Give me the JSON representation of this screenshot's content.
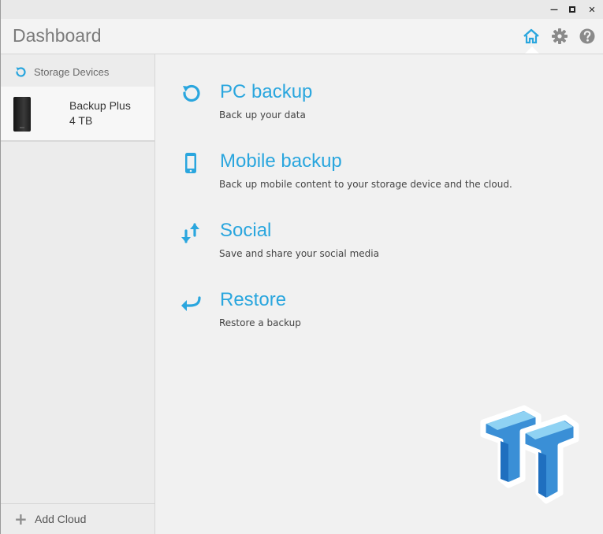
{
  "window": {
    "minimize_glyph": "—",
    "maximize_glyph": "▣",
    "close_glyph": "✕"
  },
  "header": {
    "title": "Dashboard",
    "icons": [
      "home-icon",
      "gear-icon",
      "help-icon"
    ]
  },
  "sidebar": {
    "section_title": "Storage Devices",
    "devices": [
      {
        "name": "Backup Plus",
        "capacity": "4 TB"
      }
    ],
    "add_cloud_label": "Add Cloud"
  },
  "actions": [
    {
      "title": "PC backup",
      "description": "Back up your data",
      "icon": "refresh-icon"
    },
    {
      "title": "Mobile backup",
      "description": "Back up mobile content to your storage device and the cloud.",
      "icon": "phone-icon"
    },
    {
      "title": "Social",
      "description": "Save and share your social media",
      "icon": "transfer-arrows-icon"
    },
    {
      "title": "Restore",
      "description": "Restore a backup",
      "icon": "return-arrow-icon"
    }
  ],
  "colors": {
    "accent": "#2aa6de",
    "title_gray": "#7b7b7b",
    "background": "#f1f1f1"
  }
}
